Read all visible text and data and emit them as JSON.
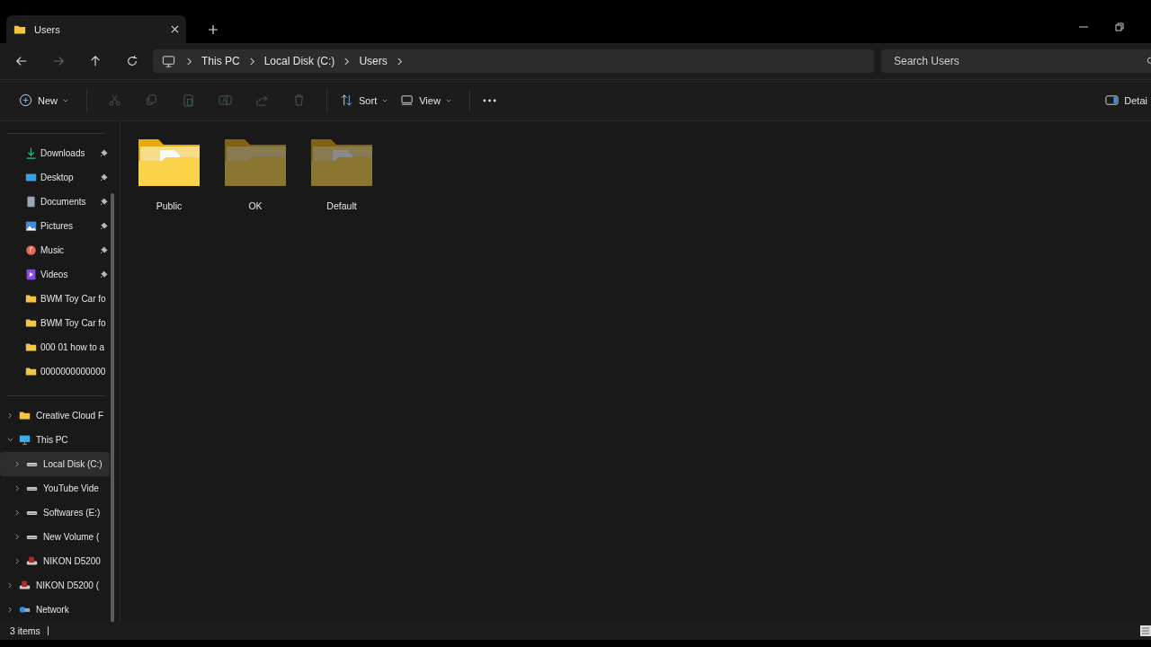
{
  "tab": {
    "title": "Users",
    "selected": true
  },
  "address": {
    "segments": [
      "This PC",
      "Local Disk (C:)",
      "Users"
    ]
  },
  "search": {
    "placeholder": "Search Users"
  },
  "toolbar": {
    "new": "New",
    "sort": "Sort",
    "view": "View",
    "details": "Detai"
  },
  "quick_access": [
    {
      "label": "Downloads",
      "kind": "download",
      "pinned": true
    },
    {
      "label": "Desktop",
      "kind": "desktop",
      "pinned": true
    },
    {
      "label": "Documents",
      "kind": "documents",
      "pinned": true
    },
    {
      "label": "Pictures",
      "kind": "pictures",
      "pinned": true
    },
    {
      "label": "Music",
      "kind": "music",
      "pinned": true
    },
    {
      "label": "Videos",
      "kind": "videos",
      "pinned": true
    },
    {
      "label": "BWM Toy Car fo",
      "kind": "folder",
      "pinned": false
    },
    {
      "label": "BWM Toy Car fo",
      "kind": "folder",
      "pinned": false
    },
    {
      "label": "000 01 how to a",
      "kind": "folder",
      "pinned": false
    },
    {
      "label": "0000000000000",
      "kind": "folder",
      "pinned": false
    }
  ],
  "tree": [
    {
      "label": "Creative Cloud F",
      "kind": "folder",
      "expanded": false,
      "selected": false
    },
    {
      "label": "This PC",
      "kind": "pc",
      "expanded": true,
      "selected": false,
      "children": [
        {
          "label": "Local Disk (C:)",
          "kind": "drive",
          "expanded": false,
          "selected": true
        },
        {
          "label": "YouTube Vide",
          "kind": "drive",
          "expanded": false,
          "selected": false
        },
        {
          "label": "Softwares (E:)",
          "kind": "drive",
          "expanded": false,
          "selected": false
        },
        {
          "label": "New Volume (",
          "kind": "drive",
          "expanded": false,
          "selected": false
        },
        {
          "label": "NIKON D5200",
          "kind": "sd",
          "expanded": false,
          "selected": false
        }
      ]
    },
    {
      "label": "NIKON D5200 (",
      "kind": "sd",
      "expanded": false,
      "selected": false
    },
    {
      "label": "Network",
      "kind": "network",
      "expanded": false,
      "selected": false
    }
  ],
  "folders": [
    {
      "name": "Public",
      "hidden": false,
      "kind": "files"
    },
    {
      "name": "OK",
      "hidden": true,
      "kind": "empty"
    },
    {
      "name": "Default",
      "hidden": true,
      "kind": "files"
    }
  ],
  "status_bar": {
    "count": "3 items"
  }
}
